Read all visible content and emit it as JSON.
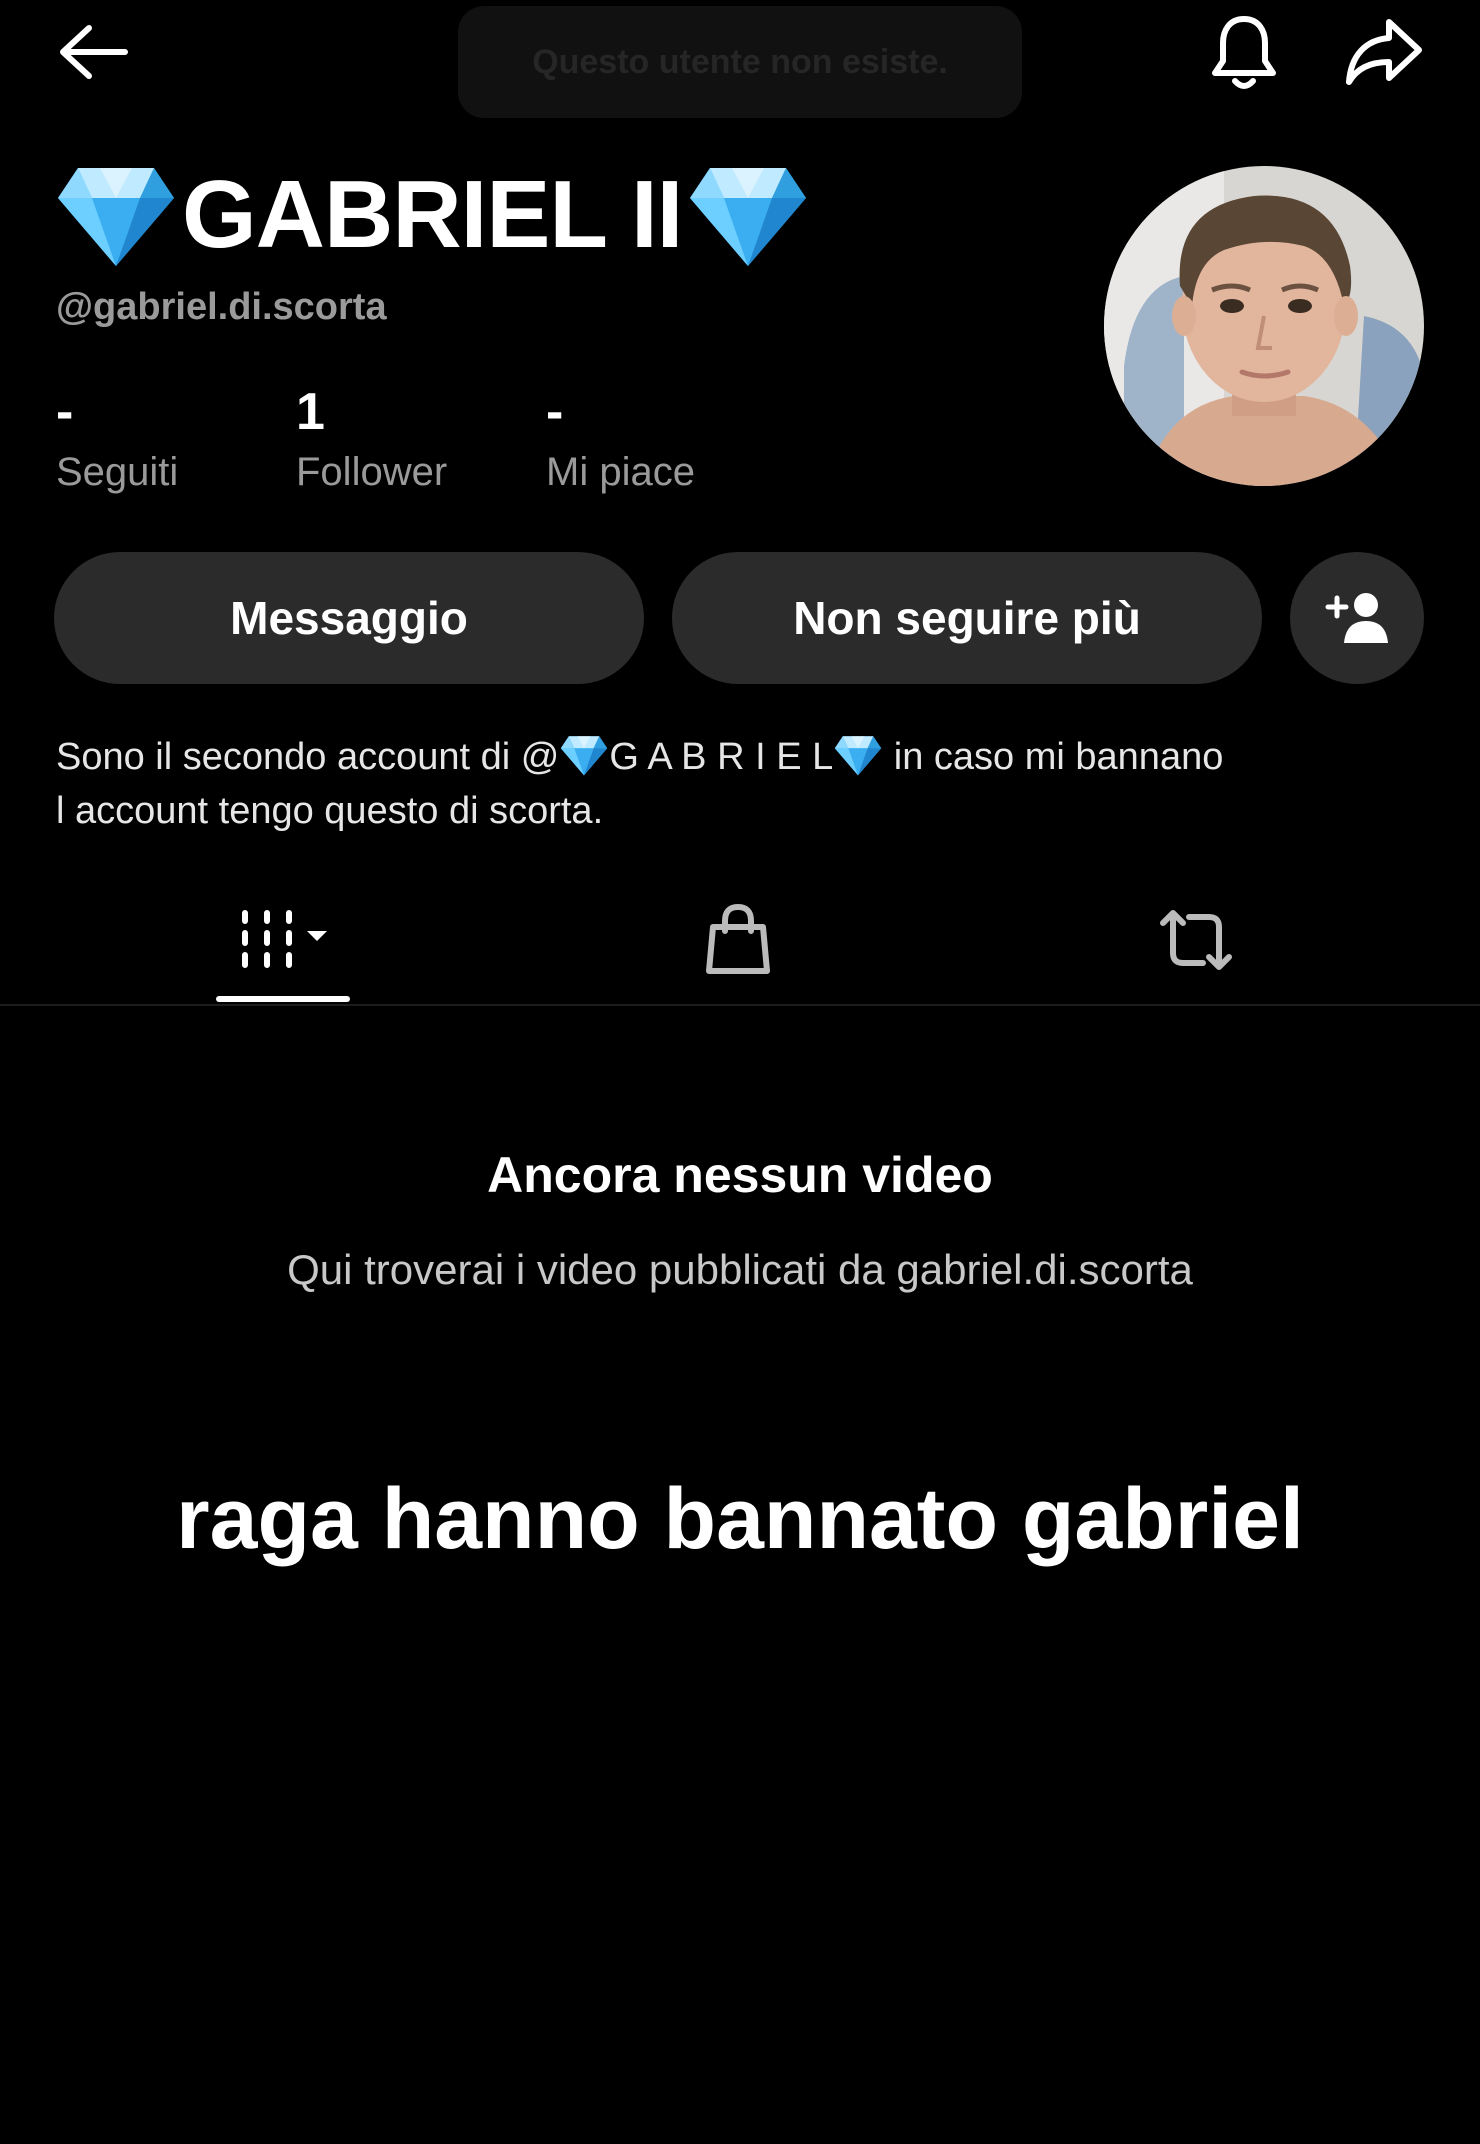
{
  "toast": {
    "text": "Questo utente non esiste."
  },
  "top_bar": {
    "back_icon": "arrow-left-icon",
    "bell_icon": "bell-icon",
    "share_icon": "share-icon"
  },
  "profile": {
    "display_name": "GABRIEL II",
    "name_emoji": "gem-icon",
    "handle": "@gabriel.di.scorta",
    "stats": [
      {
        "value": "-",
        "label": "Seguiti"
      },
      {
        "value": "1",
        "label": "Follower"
      },
      {
        "value": "-",
        "label": "Mi piace"
      }
    ]
  },
  "actions": {
    "message_label": "Messaggio",
    "unfollow_label": "Non seguire più",
    "add_friend_icon": "add-user-icon"
  },
  "bio": {
    "line1_before": "Sono il secondo account di @",
    "line1_mention": "G A B R I E L",
    "line1_after": " in caso mi bannano",
    "line2": "l account tengo questo di scorta."
  },
  "tabs": [
    {
      "icon": "videos-grid-icon",
      "active": true
    },
    {
      "icon": "shopping-bag-icon",
      "active": false
    },
    {
      "icon": "repost-icon",
      "active": false
    }
  ],
  "empty_state": {
    "title": "Ancora nessun video",
    "subtitle": "Qui troverai i video pubblicati da gabriel.di.scorta"
  },
  "caption": "raga hanno bannato gabriel",
  "colors": {
    "background": "#000000",
    "button_bg": "#2b2b2b",
    "secondary_text": "#9a9a9a",
    "gem_blue": "#5fc8ff"
  }
}
